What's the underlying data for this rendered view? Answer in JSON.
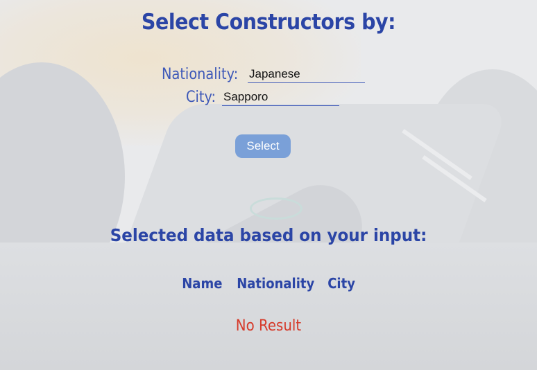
{
  "page": {
    "title": "Select Constructors by:",
    "accent_color": "#2b45a6",
    "error_color": "#d63a2a"
  },
  "form": {
    "nationality_label": "Nationality:",
    "nationality_value": "Japanese",
    "city_label": "City:",
    "city_value": "Sapporo",
    "select_button": "Select"
  },
  "results": {
    "heading": "Selected data based on your input:",
    "columns": [
      "Name",
      "Nationality",
      "City"
    ],
    "empty_message": "No Result"
  }
}
